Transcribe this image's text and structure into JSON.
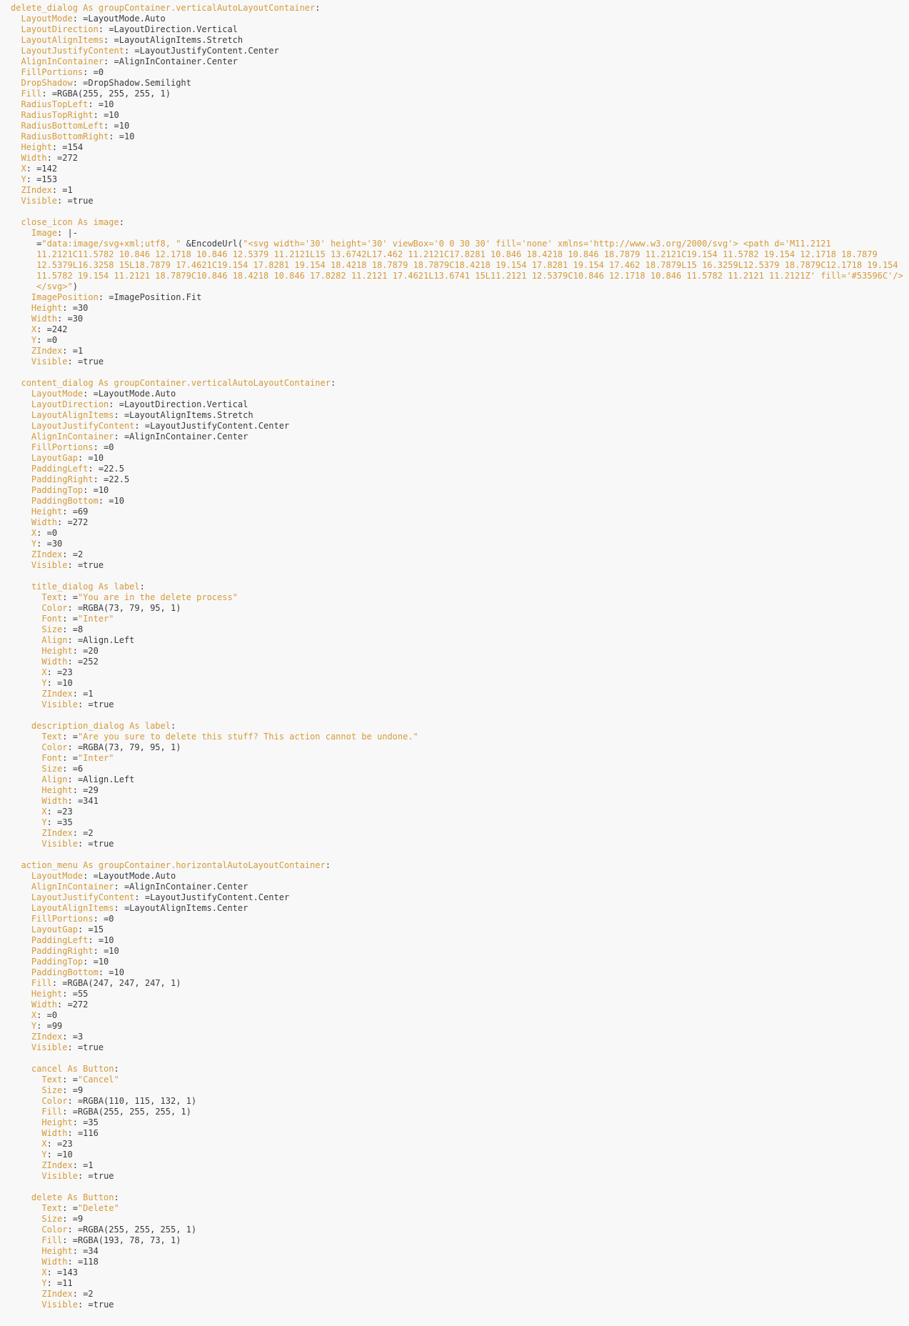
{
  "colors": {
    "key": "#d49a3a",
    "value": "#3a3a3a",
    "string": "#d49a3a",
    "background": "#f8f8f8"
  },
  "lines": [
    {
      "indent": 0,
      "key": "delete_dialog As groupContainer.verticalAutoLayoutContainer",
      "sep": ":",
      "val": "",
      "type": "header"
    },
    {
      "indent": 1,
      "key": "LayoutMode",
      "sep": ": ",
      "val": "=LayoutMode.Auto"
    },
    {
      "indent": 1,
      "key": "LayoutDirection",
      "sep": ": ",
      "val": "=LayoutDirection.Vertical"
    },
    {
      "indent": 1,
      "key": "LayoutAlignItems",
      "sep": ": ",
      "val": "=LayoutAlignItems.Stretch"
    },
    {
      "indent": 1,
      "key": "LayoutJustifyContent",
      "sep": ": ",
      "val": "=LayoutJustifyContent.Center"
    },
    {
      "indent": 1,
      "key": "AlignInContainer",
      "sep": ": ",
      "val": "=AlignInContainer.Center"
    },
    {
      "indent": 1,
      "key": "FillPortions",
      "sep": ": ",
      "val": "=0"
    },
    {
      "indent": 1,
      "key": "DropShadow",
      "sep": ": ",
      "val": "=DropShadow.Semilight"
    },
    {
      "indent": 1,
      "key": "Fill",
      "sep": ": ",
      "val": "=RGBA(255, 255, 255, 1)"
    },
    {
      "indent": 1,
      "key": "RadiusTopLeft",
      "sep": ": ",
      "val": "=10"
    },
    {
      "indent": 1,
      "key": "RadiusTopRight",
      "sep": ": ",
      "val": "=10"
    },
    {
      "indent": 1,
      "key": "RadiusBottomLeft",
      "sep": ": ",
      "val": "=10"
    },
    {
      "indent": 1,
      "key": "RadiusBottomRight",
      "sep": ": ",
      "val": "=10"
    },
    {
      "indent": 1,
      "key": "Height",
      "sep": ": ",
      "val": "=154"
    },
    {
      "indent": 1,
      "key": "Width",
      "sep": ": ",
      "val": "=272"
    },
    {
      "indent": 1,
      "key": "X",
      "sep": ": ",
      "val": "=142"
    },
    {
      "indent": 1,
      "key": "Y",
      "sep": ": ",
      "val": "=153"
    },
    {
      "indent": 1,
      "key": "ZIndex",
      "sep": ": ",
      "val": "=1"
    },
    {
      "indent": 1,
      "key": "Visible",
      "sep": ": ",
      "val": "=true"
    },
    {
      "blank": true
    },
    {
      "indent": 1,
      "key": "close_icon As image",
      "sep": ":",
      "val": "",
      "type": "header"
    },
    {
      "indent": 2,
      "key": "Image",
      "sep": ": ",
      "val": "|-"
    },
    {
      "indent": 2,
      "key": "",
      "sep": "",
      "val": "=",
      "str": "\"data:image/svg+xml;utf8, \"",
      "after": " &EncodeUrl(",
      "str2": "\"<svg width='30' height='30' viewBox='0 0 30 30' fill='none' xmlns='http://www.w3.org/2000/svg'> <path d='M11.2121"
    },
    {
      "indent": 2,
      "key": "",
      "sep": "",
      "val": " ",
      "str": "11.2121C11.5782 10.846 12.1718 10.846 12.5379 11.2121L15 13.6742L17.462 11.2121C17.8281 10.846 18.4218 10.846 18.7879 11.2121C19.154 11.5782 19.154 12.1718 18.7879"
    },
    {
      "indent": 2,
      "key": "",
      "sep": "",
      "val": " ",
      "str": "12.5379L16.3258 15L18.7879 17.4621C19.154 17.8281 19.154 18.4218 18.7879 18.7879C18.4218 19.154 17.8281 19.154 17.462 18.7879L15 16.3259L12.5379 18.7879C12.1718 19.154"
    },
    {
      "indent": 2,
      "key": "",
      "sep": "",
      "val": " ",
      "str": "11.5782 19.154 11.2121 18.7879C10.846 18.4218 10.846 17.8282 11.2121 17.4621L13.6741 15L11.2121 12.5379C10.846 12.1718 10.846 11.5782 11.2121 11.2121Z' fill='#53596C'/>"
    },
    {
      "indent": 2,
      "key": "",
      "sep": "",
      "val": " ",
      "str": "</svg>\"",
      "after": ")"
    },
    {
      "indent": 2,
      "key": "ImagePosition",
      "sep": ": ",
      "val": "=ImagePosition.Fit"
    },
    {
      "indent": 2,
      "key": "Height",
      "sep": ": ",
      "val": "=30"
    },
    {
      "indent": 2,
      "key": "Width",
      "sep": ": ",
      "val": "=30"
    },
    {
      "indent": 2,
      "key": "X",
      "sep": ": ",
      "val": "=242"
    },
    {
      "indent": 2,
      "key": "Y",
      "sep": ": ",
      "val": "=0"
    },
    {
      "indent": 2,
      "key": "ZIndex",
      "sep": ": ",
      "val": "=1"
    },
    {
      "indent": 2,
      "key": "Visible",
      "sep": ": ",
      "val": "=true"
    },
    {
      "blank": true
    },
    {
      "indent": 1,
      "key": "content_dialog As groupContainer.verticalAutoLayoutContainer",
      "sep": ":",
      "val": "",
      "type": "header"
    },
    {
      "indent": 2,
      "key": "LayoutMode",
      "sep": ": ",
      "val": "=LayoutMode.Auto"
    },
    {
      "indent": 2,
      "key": "LayoutDirection",
      "sep": ": ",
      "val": "=LayoutDirection.Vertical"
    },
    {
      "indent": 2,
      "key": "LayoutAlignItems",
      "sep": ": ",
      "val": "=LayoutAlignItems.Stretch"
    },
    {
      "indent": 2,
      "key": "LayoutJustifyContent",
      "sep": ": ",
      "val": "=LayoutJustifyContent.Center"
    },
    {
      "indent": 2,
      "key": "AlignInContainer",
      "sep": ": ",
      "val": "=AlignInContainer.Center"
    },
    {
      "indent": 2,
      "key": "FillPortions",
      "sep": ": ",
      "val": "=0"
    },
    {
      "indent": 2,
      "key": "LayoutGap",
      "sep": ": ",
      "val": "=10"
    },
    {
      "indent": 2,
      "key": "PaddingLeft",
      "sep": ": ",
      "val": "=22.5"
    },
    {
      "indent": 2,
      "key": "PaddingRight",
      "sep": ": ",
      "val": "=22.5"
    },
    {
      "indent": 2,
      "key": "PaddingTop",
      "sep": ": ",
      "val": "=10"
    },
    {
      "indent": 2,
      "key": "PaddingBottom",
      "sep": ": ",
      "val": "=10"
    },
    {
      "indent": 2,
      "key": "Height",
      "sep": ": ",
      "val": "=69"
    },
    {
      "indent": 2,
      "key": "Width",
      "sep": ": ",
      "val": "=272"
    },
    {
      "indent": 2,
      "key": "X",
      "sep": ": ",
      "val": "=0"
    },
    {
      "indent": 2,
      "key": "Y",
      "sep": ": ",
      "val": "=30"
    },
    {
      "indent": 2,
      "key": "ZIndex",
      "sep": ": ",
      "val": "=2"
    },
    {
      "indent": 2,
      "key": "Visible",
      "sep": ": ",
      "val": "=true"
    },
    {
      "blank": true
    },
    {
      "indent": 2,
      "key": "title_dialog As label",
      "sep": ":",
      "val": "",
      "type": "header"
    },
    {
      "indent": 3,
      "key": "Text",
      "sep": ": ",
      "val": "=",
      "str": "\"You are in the delete process\""
    },
    {
      "indent": 3,
      "key": "Color",
      "sep": ": ",
      "val": "=RGBA(73, 79, 95, 1)"
    },
    {
      "indent": 3,
      "key": "Font",
      "sep": ": ",
      "val": "=",
      "str": "\"Inter\""
    },
    {
      "indent": 3,
      "key": "Size",
      "sep": ": ",
      "val": "=8"
    },
    {
      "indent": 3,
      "key": "Align",
      "sep": ": ",
      "val": "=Align.Left"
    },
    {
      "indent": 3,
      "key": "Height",
      "sep": ": ",
      "val": "=20"
    },
    {
      "indent": 3,
      "key": "Width",
      "sep": ": ",
      "val": "=252"
    },
    {
      "indent": 3,
      "key": "X",
      "sep": ": ",
      "val": "=23"
    },
    {
      "indent": 3,
      "key": "Y",
      "sep": ": ",
      "val": "=10"
    },
    {
      "indent": 3,
      "key": "ZIndex",
      "sep": ": ",
      "val": "=1"
    },
    {
      "indent": 3,
      "key": "Visible",
      "sep": ": ",
      "val": "=true"
    },
    {
      "blank": true
    },
    {
      "indent": 2,
      "key": "description_dialog As label",
      "sep": ":",
      "val": "",
      "type": "header"
    },
    {
      "indent": 3,
      "key": "Text",
      "sep": ": ",
      "val": "=",
      "str": "\"Are you sure to delete this stuff? This action cannot be undone.\""
    },
    {
      "indent": 3,
      "key": "Color",
      "sep": ": ",
      "val": "=RGBA(73, 79, 95, 1)"
    },
    {
      "indent": 3,
      "key": "Font",
      "sep": ": ",
      "val": "=",
      "str": "\"Inter\""
    },
    {
      "indent": 3,
      "key": "Size",
      "sep": ": ",
      "val": "=6"
    },
    {
      "indent": 3,
      "key": "Align",
      "sep": ": ",
      "val": "=Align.Left"
    },
    {
      "indent": 3,
      "key": "Height",
      "sep": ": ",
      "val": "=29"
    },
    {
      "indent": 3,
      "key": "Width",
      "sep": ": ",
      "val": "=341"
    },
    {
      "indent": 3,
      "key": "X",
      "sep": ": ",
      "val": "=23"
    },
    {
      "indent": 3,
      "key": "Y",
      "sep": ": ",
      "val": "=35"
    },
    {
      "indent": 3,
      "key": "ZIndex",
      "sep": ": ",
      "val": "=2"
    },
    {
      "indent": 3,
      "key": "Visible",
      "sep": ": ",
      "val": "=true"
    },
    {
      "blank": true
    },
    {
      "indent": 1,
      "key": "action_menu As groupContainer.horizontalAutoLayoutContainer",
      "sep": ":",
      "val": "",
      "type": "header"
    },
    {
      "indent": 2,
      "key": "LayoutMode",
      "sep": ": ",
      "val": "=LayoutMode.Auto"
    },
    {
      "indent": 2,
      "key": "AlignInContainer",
      "sep": ": ",
      "val": "=AlignInContainer.Center"
    },
    {
      "indent": 2,
      "key": "LayoutJustifyContent",
      "sep": ": ",
      "val": "=LayoutJustifyContent.Center"
    },
    {
      "indent": 2,
      "key": "LayoutAlignItems",
      "sep": ": ",
      "val": "=LayoutAlignItems.Center"
    },
    {
      "indent": 2,
      "key": "FillPortions",
      "sep": ": ",
      "val": "=0"
    },
    {
      "indent": 2,
      "key": "LayoutGap",
      "sep": ": ",
      "val": "=15"
    },
    {
      "indent": 2,
      "key": "PaddingLeft",
      "sep": ": ",
      "val": "=10"
    },
    {
      "indent": 2,
      "key": "PaddingRight",
      "sep": ": ",
      "val": "=10"
    },
    {
      "indent": 2,
      "key": "PaddingTop",
      "sep": ": ",
      "val": "=10"
    },
    {
      "indent": 2,
      "key": "PaddingBottom",
      "sep": ": ",
      "val": "=10"
    },
    {
      "indent": 2,
      "key": "Fill",
      "sep": ": ",
      "val": "=RGBA(247, 247, 247, 1)"
    },
    {
      "indent": 2,
      "key": "Height",
      "sep": ": ",
      "val": "=55"
    },
    {
      "indent": 2,
      "key": "Width",
      "sep": ": ",
      "val": "=272"
    },
    {
      "indent": 2,
      "key": "X",
      "sep": ": ",
      "val": "=0"
    },
    {
      "indent": 2,
      "key": "Y",
      "sep": ": ",
      "val": "=99"
    },
    {
      "indent": 2,
      "key": "ZIndex",
      "sep": ": ",
      "val": "=3"
    },
    {
      "indent": 2,
      "key": "Visible",
      "sep": ": ",
      "val": "=true"
    },
    {
      "blank": true
    },
    {
      "indent": 2,
      "key": "cancel As Button",
      "sep": ":",
      "val": "",
      "type": "header"
    },
    {
      "indent": 3,
      "key": "Text",
      "sep": ": ",
      "val": "=",
      "str": "\"Cancel\""
    },
    {
      "indent": 3,
      "key": "Size",
      "sep": ": ",
      "val": "=9"
    },
    {
      "indent": 3,
      "key": "Color",
      "sep": ": ",
      "val": "=RGBA(110, 115, 132, 1)"
    },
    {
      "indent": 3,
      "key": "Fill",
      "sep": ": ",
      "val": "=RGBA(255, 255, 255, 1)"
    },
    {
      "indent": 3,
      "key": "Height",
      "sep": ": ",
      "val": "=35"
    },
    {
      "indent": 3,
      "key": "Width",
      "sep": ": ",
      "val": "=116"
    },
    {
      "indent": 3,
      "key": "X",
      "sep": ": ",
      "val": "=23"
    },
    {
      "indent": 3,
      "key": "Y",
      "sep": ": ",
      "val": "=10"
    },
    {
      "indent": 3,
      "key": "ZIndex",
      "sep": ": ",
      "val": "=1"
    },
    {
      "indent": 3,
      "key": "Visible",
      "sep": ": ",
      "val": "=true"
    },
    {
      "blank": true
    },
    {
      "indent": 2,
      "key": "delete As Button",
      "sep": ":",
      "val": "",
      "type": "header"
    },
    {
      "indent": 3,
      "key": "Text",
      "sep": ": ",
      "val": "=",
      "str": "\"Delete\""
    },
    {
      "indent": 3,
      "key": "Size",
      "sep": ": ",
      "val": "=9"
    },
    {
      "indent": 3,
      "key": "Color",
      "sep": ": ",
      "val": "=RGBA(255, 255, 255, 1)"
    },
    {
      "indent": 3,
      "key": "Fill",
      "sep": ": ",
      "val": "=RGBA(193, 78, 73, 1)"
    },
    {
      "indent": 3,
      "key": "Height",
      "sep": ": ",
      "val": "=34"
    },
    {
      "indent": 3,
      "key": "Width",
      "sep": ": ",
      "val": "=118"
    },
    {
      "indent": 3,
      "key": "X",
      "sep": ": ",
      "val": "=143"
    },
    {
      "indent": 3,
      "key": "Y",
      "sep": ": ",
      "val": "=11"
    },
    {
      "indent": 3,
      "key": "ZIndex",
      "sep": ": ",
      "val": "=2"
    },
    {
      "indent": 3,
      "key": "Visible",
      "sep": ": ",
      "val": "=true"
    }
  ]
}
